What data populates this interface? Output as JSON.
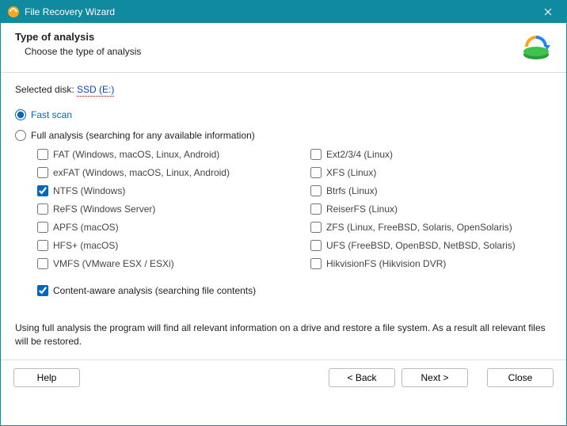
{
  "titlebar": {
    "title": "File Recovery Wizard"
  },
  "header": {
    "heading": "Type of analysis",
    "subtitle": "Choose the type of analysis"
  },
  "selected_disk": {
    "label": "Selected disk: ",
    "value": "SSD (E:)"
  },
  "scan_modes": {
    "fast": {
      "label": "Fast scan",
      "selected": true
    },
    "full": {
      "label": "Full analysis (searching for any available information)",
      "selected": false
    }
  },
  "filesystems": {
    "left": [
      {
        "id": "fat",
        "label": "FAT (Windows, macOS, Linux, Android)",
        "checked": false
      },
      {
        "id": "exfat",
        "label": "exFAT (Windows, macOS, Linux, Android)",
        "checked": false
      },
      {
        "id": "ntfs",
        "label": "NTFS (Windows)",
        "checked": true
      },
      {
        "id": "refs",
        "label": "ReFS (Windows Server)",
        "checked": false
      },
      {
        "id": "apfs",
        "label": "APFS (macOS)",
        "checked": false
      },
      {
        "id": "hfs",
        "label": "HFS+ (macOS)",
        "checked": false
      },
      {
        "id": "vmfs",
        "label": "VMFS (VMware ESX / ESXi)",
        "checked": false
      }
    ],
    "right": [
      {
        "id": "ext",
        "label": "Ext2/3/4 (Linux)",
        "checked": false
      },
      {
        "id": "xfs",
        "label": "XFS (Linux)",
        "checked": false
      },
      {
        "id": "btrfs",
        "label": "Btrfs (Linux)",
        "checked": false
      },
      {
        "id": "reiser",
        "label": "ReiserFS (Linux)",
        "checked": false
      },
      {
        "id": "zfs",
        "label": "ZFS (Linux, FreeBSD, Solaris, OpenSolaris)",
        "checked": false
      },
      {
        "id": "ufs",
        "label": "UFS (FreeBSD, OpenBSD, NetBSD, Solaris)",
        "checked": false
      },
      {
        "id": "hikvision",
        "label": "HikvisionFS (Hikvision DVR)",
        "checked": false
      }
    ]
  },
  "content_aware": {
    "label": "Content-aware analysis (searching file contents)",
    "checked": true
  },
  "hint": "Using full analysis the program will find all relevant information on a drive and restore a file system. As a result all relevant files will be restored.",
  "footer": {
    "help": "Help",
    "back": "< Back",
    "next": "Next >",
    "close": "Close"
  }
}
